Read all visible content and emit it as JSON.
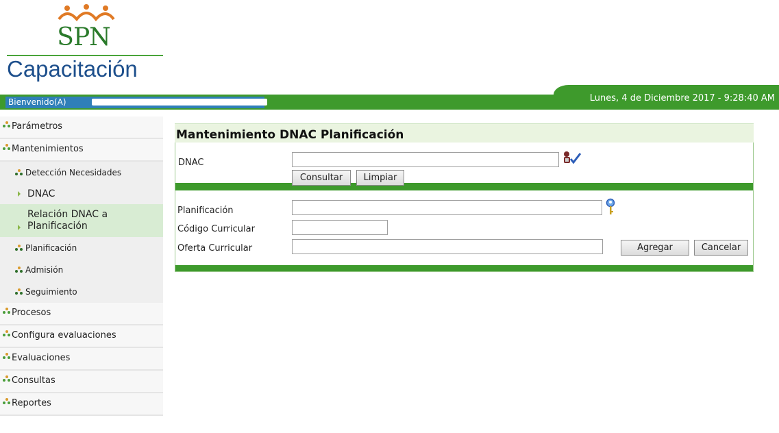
{
  "app": {
    "logo_text": "SPN",
    "logo_subtitle": "Capacitación",
    "welcome_label": "Bienvenido(A)",
    "datetime": "Lunes, 4 de Diciembre 2017 - 9:28:40 AM",
    "brand_color": "#3e9a2c"
  },
  "sidebar": {
    "items": [
      {
        "label": "Parámetros"
      },
      {
        "label": "Mantenimientos"
      },
      {
        "label": "Procesos"
      },
      {
        "label": "Configura evaluaciones"
      },
      {
        "label": "Evaluaciones"
      },
      {
        "label": "Consultas"
      },
      {
        "label": "Reportes"
      }
    ],
    "sub": {
      "deteccion": "Detección Necesidades",
      "dnac": "DNAC",
      "relacion": "Relación DNAC a Planificación",
      "planificacion": "Planificación",
      "admision": "Admisión",
      "seguimiento": "Seguimiento"
    }
  },
  "form": {
    "title": "Mantenimiento DNAC Planificación",
    "dnac_label": "DNAC",
    "dnac_value": "",
    "consultar_label": "Consultar",
    "limpiar_label": "Limpiar",
    "planificacion_label": "Planificación",
    "planificacion_value": "",
    "codigo_label": "Código Curricular",
    "codigo_value": "",
    "oferta_label": "Oferta Curricular",
    "oferta_value": "",
    "agregar_label": "Agregar",
    "cancelar_label": "Cancelar"
  }
}
